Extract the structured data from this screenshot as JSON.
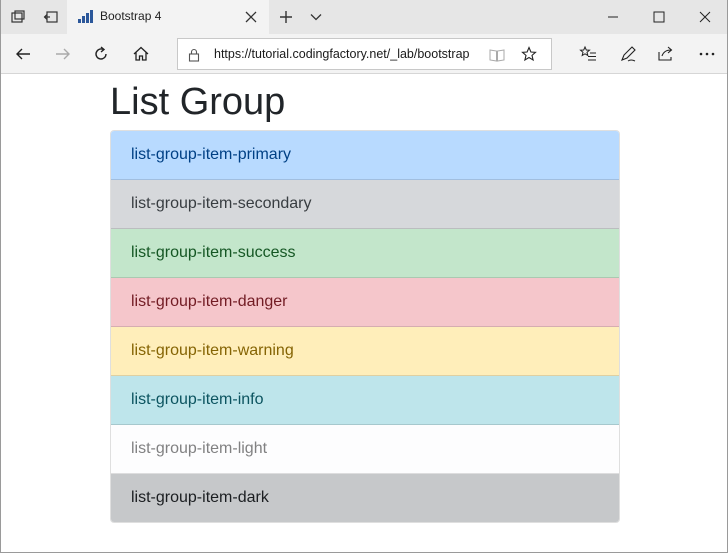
{
  "browser": {
    "tab_title": "Bootstrap 4",
    "url": "https://tutorial.codingfactory.net/_lab/bootstrap",
    "accent": "#2b579a"
  },
  "page": {
    "heading": "List Group",
    "items": [
      {
        "label": "list-group-item-primary",
        "variant": "primary",
        "bg": "#b8daff",
        "fg": "#004085"
      },
      {
        "label": "list-group-item-secondary",
        "variant": "secondary",
        "bg": "#d6d8db",
        "fg": "#383d41"
      },
      {
        "label": "list-group-item-success",
        "variant": "success",
        "bg": "#c3e6cb",
        "fg": "#155724"
      },
      {
        "label": "list-group-item-danger",
        "variant": "danger",
        "bg": "#f5c6cb",
        "fg": "#721c24"
      },
      {
        "label": "list-group-item-warning",
        "variant": "warning",
        "bg": "#ffeeba",
        "fg": "#856404"
      },
      {
        "label": "list-group-item-info",
        "variant": "info",
        "bg": "#bee5eb",
        "fg": "#0c5460"
      },
      {
        "label": "list-group-item-light",
        "variant": "light",
        "bg": "#fdfdfe",
        "fg": "#818182"
      },
      {
        "label": "list-group-item-dark",
        "variant": "dark",
        "bg": "#c6c8ca",
        "fg": "#1b1e21"
      }
    ]
  }
}
